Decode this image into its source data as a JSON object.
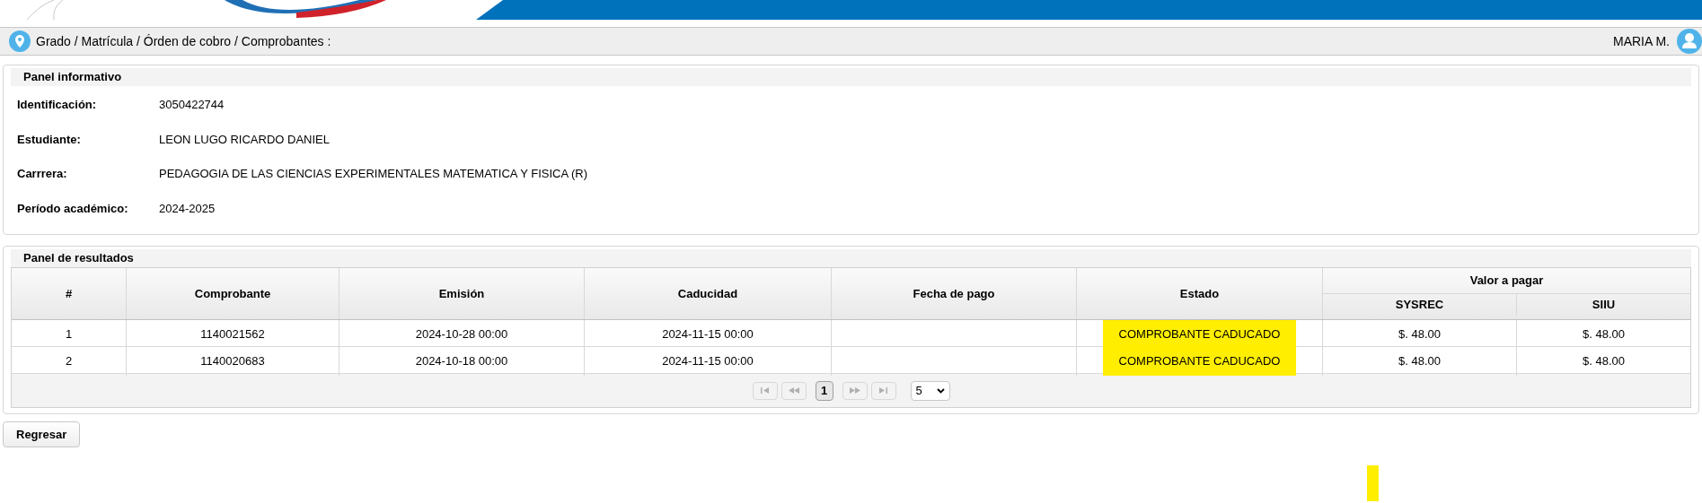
{
  "breadcrumb": "Grado / Matrícula / Órden de cobro / Comprobantes :",
  "user": "MARIA M.",
  "info_panel": {
    "title": "Panel informativo",
    "fields": [
      {
        "label": "Identificación:",
        "value": "3050422744"
      },
      {
        "label": "Estudiante:",
        "value": "LEON LUGO RICARDO DANIEL"
      },
      {
        "label": "Carrrera:",
        "value": "PEDAGOGIA DE LAS CIENCIAS EXPERIMENTALES MATEMATICA Y FISICA (R)"
      },
      {
        "label": "Período académico:",
        "value": "2024-2025"
      }
    ]
  },
  "results_panel": {
    "title": "Panel de resultados",
    "columns": [
      "#",
      "Comprobante",
      "Emisión",
      "Caducidad",
      "Fecha de pago",
      "Estado"
    ],
    "group_column": {
      "label": "Valor a pagar",
      "subcolumns": [
        "SYSREC",
        "SIIU"
      ]
    },
    "rows": [
      {
        "cells": [
          "1",
          "1140021562",
          "2024-10-28 00:00",
          "2024-11-15 00:00",
          "",
          "COMPROBANTE CADUCADO",
          "$. 48.00",
          "$. 48.00"
        ],
        "highlighted": true
      },
      {
        "cells": [
          "2",
          "1140020683",
          "2024-10-18 00:00",
          "2024-11-15 00:00",
          "",
          "COMPROBANTE CADUCADO",
          "$. 48.00",
          "$. 48.00"
        ],
        "highlighted": true
      }
    ],
    "pager": {
      "pages": [
        {
          "label": "1",
          "selected": true
        }
      ],
      "page_size": "5"
    }
  },
  "back_button": "Regresar"
}
